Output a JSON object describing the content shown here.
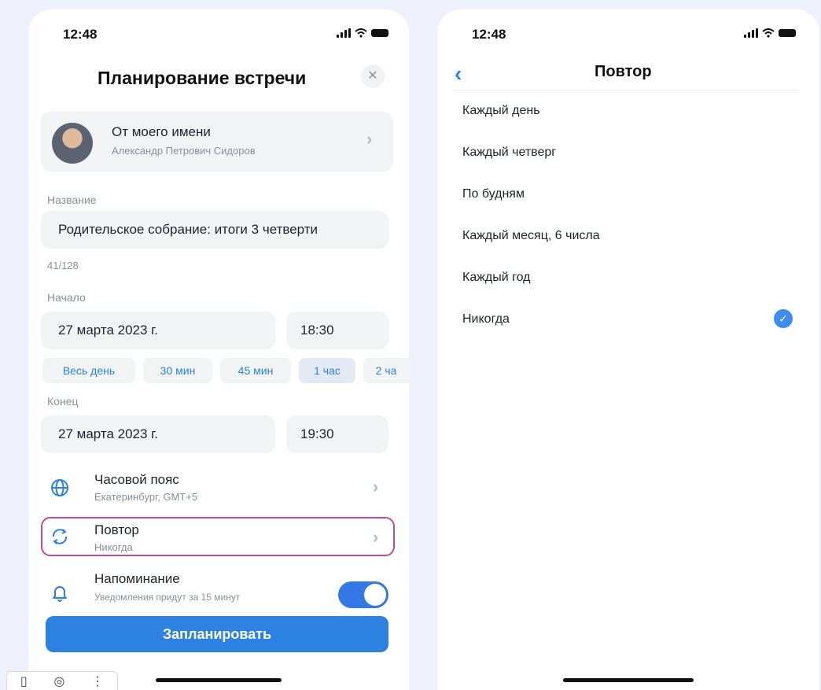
{
  "left_screen": {
    "status_time": "12:48",
    "title": "Планирование встречи",
    "close_icon": "close-icon",
    "author": {
      "title": "От моего имени",
      "name": "Александр Петрович Сидоров"
    },
    "name_field": {
      "label": "Название",
      "value": "Родительское собрание: итоги 3 четверти",
      "counter": "41/128"
    },
    "start": {
      "label": "Начало",
      "date": "27 марта 2023 г.",
      "time": "18:30"
    },
    "duration_chips": [
      {
        "label": "Весь день"
      },
      {
        "label": "30 мин"
      },
      {
        "label": "45 мин"
      },
      {
        "label": "1 час",
        "selected": true
      },
      {
        "label": "2 ча"
      }
    ],
    "end": {
      "label": "Конец",
      "date": "27 марта 2023 г.",
      "time": "19:30"
    },
    "timezone": {
      "title": "Часовой пояс",
      "value": "Екатеринбург, GMT+5",
      "icon": "globe-icon"
    },
    "repeat": {
      "title": "Повтор",
      "value": "Никогда",
      "icon": "repeat-icon",
      "highlight_color": "#c24a91"
    },
    "reminder": {
      "title": "Напоминание",
      "value": "Уведомления придут за 15 минут",
      "icon": "bell-icon",
      "enabled": true
    },
    "submit_label": "Запланировать"
  },
  "right_screen": {
    "status_time": "12:48",
    "title": "Повтор",
    "back_icon": "chevron-left-icon",
    "options": [
      {
        "label": "Каждый день"
      },
      {
        "label": "Каждый четверг"
      },
      {
        "label": "По будням"
      },
      {
        "label": "Каждый месяц, 6 числа"
      },
      {
        "label": "Каждый год"
      },
      {
        "label": "Никогда",
        "selected": true
      }
    ]
  },
  "colors": {
    "accent": "#2d81e0",
    "background": "#eef0fb"
  }
}
